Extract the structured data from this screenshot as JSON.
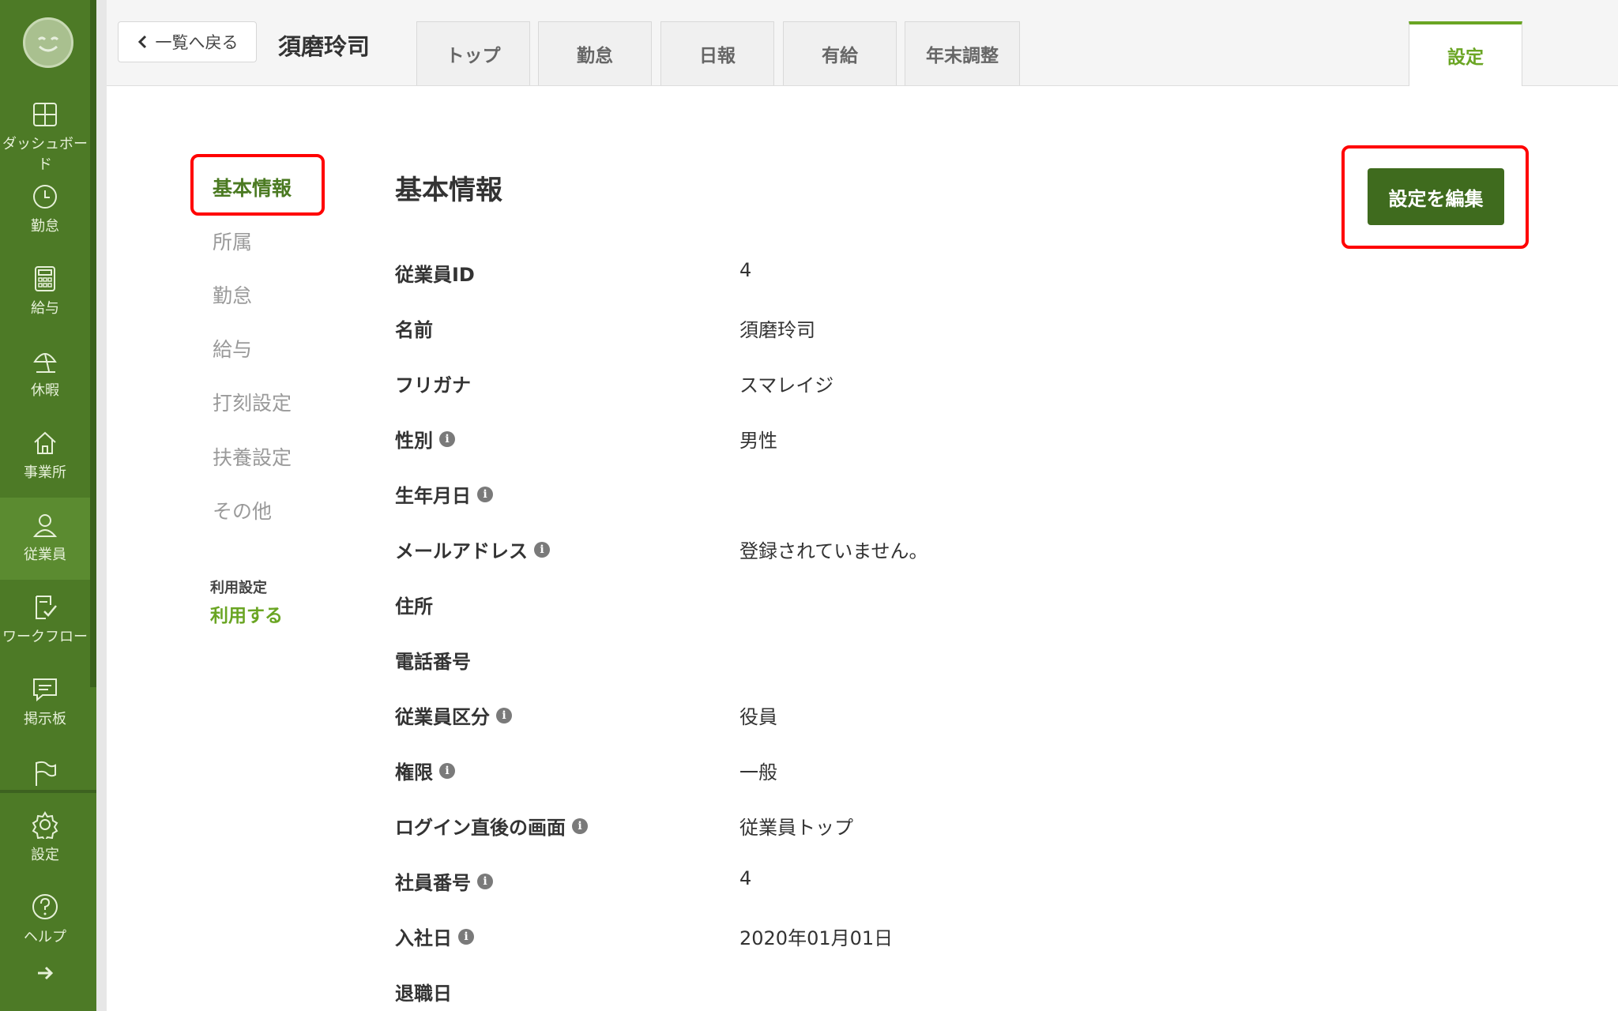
{
  "header": {
    "back_label": "一覧へ戻る",
    "employee_name": "須磨玲司",
    "tabs": [
      "トップ",
      "勤怠",
      "日報",
      "有給",
      "年末調整"
    ],
    "active_tab": "設定"
  },
  "sidebar": {
    "items": [
      {
        "label": "ダッシュボード",
        "icon": "dashboard-icon"
      },
      {
        "label": "勤怠",
        "icon": "clock-icon"
      },
      {
        "label": "給与",
        "icon": "calculator-icon"
      },
      {
        "label": "休暇",
        "icon": "beach-umbrella-icon"
      },
      {
        "label": "事業所",
        "icon": "home-icon"
      },
      {
        "label": "従業員",
        "icon": "person-icon"
      },
      {
        "label": "ワークフロー",
        "icon": "checklist-icon"
      },
      {
        "label": "掲示板",
        "icon": "chat-icon"
      },
      {
        "label": "",
        "icon": "flag-icon"
      },
      {
        "label": "設定",
        "icon": "gear-icon"
      },
      {
        "label": "ヘルプ",
        "icon": "help-icon"
      }
    ],
    "active": "従業員"
  },
  "subnav": {
    "items": [
      "基本情報",
      "所属",
      "勤怠",
      "給与",
      "打刻設定",
      "扶養設定",
      "その他"
    ],
    "active": "基本情報",
    "usage_label": "利用設定",
    "usage_value": "利用する"
  },
  "main": {
    "section_title": "基本情報",
    "edit_button": "設定を編集",
    "fields": [
      {
        "label": "従業員ID",
        "value": "4",
        "info": false
      },
      {
        "label": "名前",
        "value": "須磨玲司",
        "info": false
      },
      {
        "label": "フリガナ",
        "value": "スマレイジ",
        "info": false
      },
      {
        "label": "性別",
        "value": "男性",
        "info": true
      },
      {
        "label": "生年月日",
        "value": "",
        "info": true
      },
      {
        "label": "メールアドレス",
        "value": "登録されていません。",
        "info": true
      },
      {
        "label": "住所",
        "value": "",
        "info": false
      },
      {
        "label": "電話番号",
        "value": "",
        "info": false
      },
      {
        "label": "従業員区分",
        "value": "役員",
        "info": true
      },
      {
        "label": "権限",
        "value": "一般",
        "info": true
      },
      {
        "label": "ログイン直後の画面",
        "value": "従業員トップ",
        "info": true
      },
      {
        "label": "社員番号",
        "value": "4",
        "info": true
      },
      {
        "label": "入社日",
        "value": "2020年01月01日",
        "info": true
      },
      {
        "label": "退職日",
        "value": "",
        "info": false
      }
    ]
  },
  "colors": {
    "sidebar": "#4d7a26",
    "accent": "#6aa523",
    "button": "#3f6b1e",
    "highlight": "#ff0000"
  }
}
